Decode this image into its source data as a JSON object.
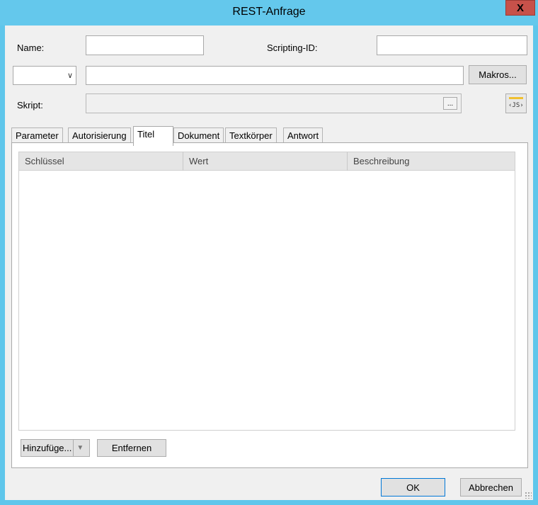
{
  "window": {
    "title": "REST-Anfrage",
    "close_label": "X"
  },
  "form": {
    "name_label": "Name:",
    "name_value": "",
    "scripting_id_label": "Scripting-ID:",
    "scripting_id_value": "",
    "method_value": "",
    "url_value": "",
    "makros_label": "Makros...",
    "skript_label": "Skript:",
    "skript_value": "",
    "ellipsis_label": "...",
    "js_label": "‹JS›"
  },
  "tabs": [
    {
      "label": "Parameter",
      "active": false
    },
    {
      "label": "Autorisierung",
      "active": false
    },
    {
      "label": "Titel",
      "active": true
    },
    {
      "label": "Dokument",
      "active": false
    },
    {
      "label": "Textkörper",
      "active": false
    },
    {
      "label": "Antwort",
      "active": false
    }
  ],
  "grid": {
    "columns": [
      "Schlüssel",
      "Wert",
      "Beschreibung"
    ],
    "rows": []
  },
  "actions": {
    "add_label": "Hinzufüge...",
    "remove_label": "Entfernen"
  },
  "footer": {
    "ok_label": "OK",
    "cancel_label": "Abbrechen"
  },
  "colors": {
    "titlebar": "#64c8ec",
    "close_button": "#c7514a",
    "dialog_bg": "#f0f0f0"
  }
}
